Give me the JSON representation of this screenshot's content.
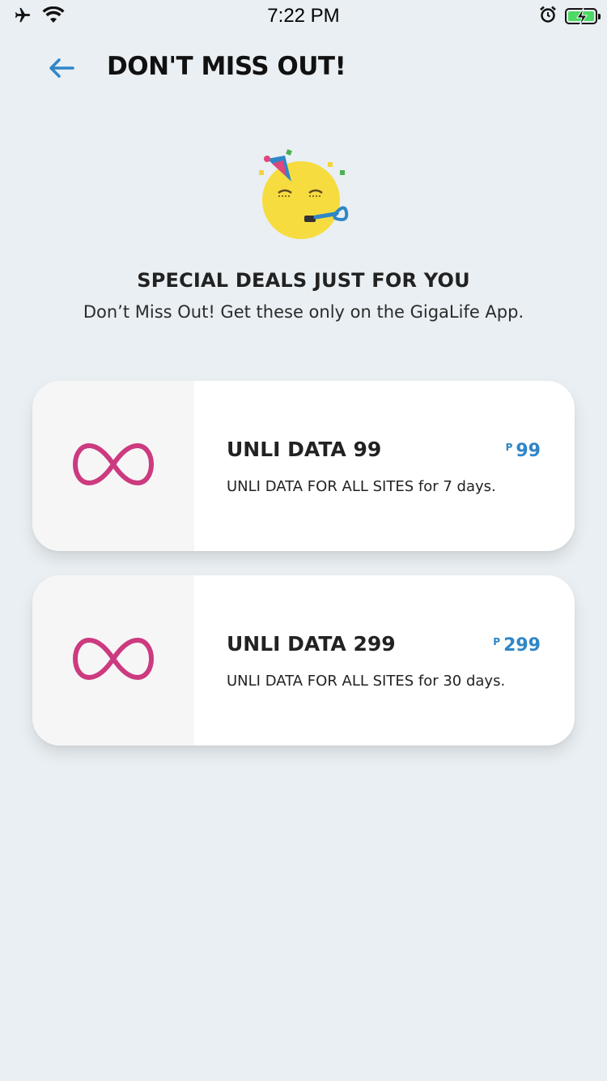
{
  "status_bar": {
    "time": "7:22 PM"
  },
  "header": {
    "title": "DON'T MISS OUT!"
  },
  "hero": {
    "title": "SPECIAL DEALS JUST FOR YOU",
    "subtitle": "Don’t Miss Out! Get these only on the GigaLife App."
  },
  "deals": [
    {
      "name": "UNLI DATA 99",
      "description": "UNLI DATA FOR ALL SITES for 7 days.",
      "currency": "P",
      "price": "99",
      "icon": "infinity-icon"
    },
    {
      "name": "UNLI DATA 299",
      "description": "UNLI DATA FOR ALL SITES for 30 days.",
      "currency": "P",
      "price": "299",
      "icon": "infinity-icon"
    }
  ],
  "colors": {
    "background": "#e9eff2",
    "accent_blue": "#2f86c7",
    "infinity_pink": "#cc3a7f",
    "battery_green": "#4cd964"
  }
}
